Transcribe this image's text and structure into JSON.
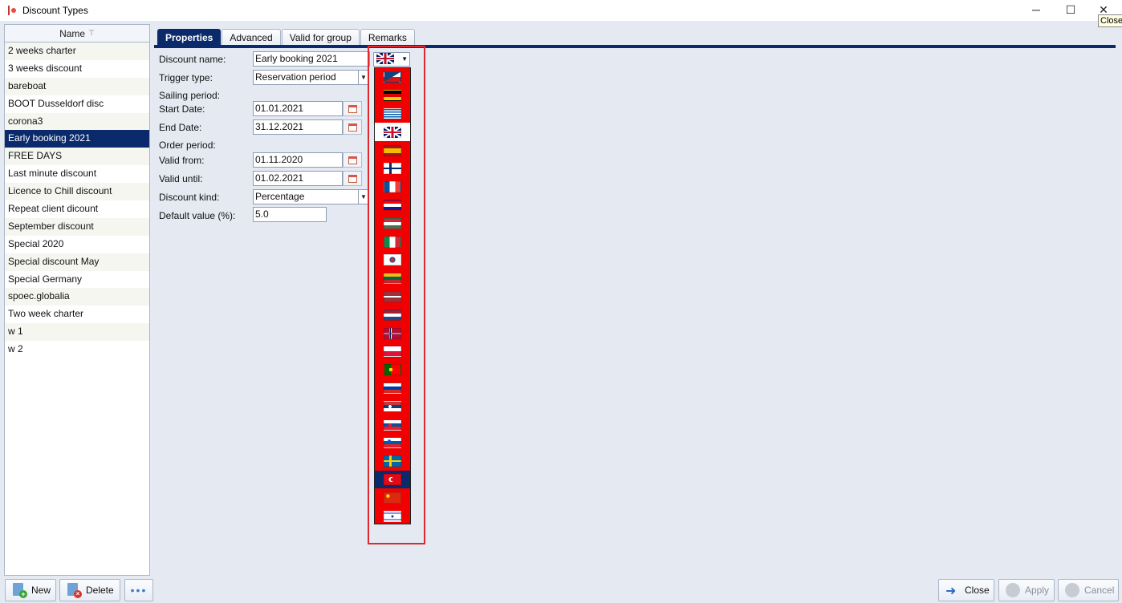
{
  "window": {
    "title": "Discount Types",
    "tooltip": "Close",
    "minimize_glyph": "─",
    "maximize_glyph": "☐",
    "close_glyph": "✕"
  },
  "list": {
    "header": "Name",
    "sort_glyph": "⊤",
    "items": [
      "2 weeks charter",
      "3 weeks discount",
      "bareboat",
      "BOOT Dusseldorf disc",
      "corona3",
      "Early booking 2021",
      "FREE DAYS",
      "Last minute discount",
      "Licence to Chill discount",
      "Repeat client dicount",
      "September discount",
      "Special 2020",
      "Special discount May",
      "Special Germany",
      "spoec.globalia",
      "Two week charter",
      "w 1",
      "w 2"
    ],
    "selected_index": 5
  },
  "tabs": [
    "Properties",
    "Advanced",
    "Valid for group",
    "Remarks"
  ],
  "form": {
    "discount_name_label": "Discount name:",
    "discount_name_value": "Early booking 2021",
    "trigger_type_label": "Trigger type:",
    "trigger_type_value": "Reservation period",
    "sailing_period_label": "Sailing period:",
    "start_date_label": "Start Date:",
    "start_date_value": "01.01.2021",
    "end_date_label": "End Date:",
    "end_date_value": "31.12.2021",
    "order_period_label": "Order period:",
    "valid_from_label": "Valid from:",
    "valid_from_value": "01.11.2020",
    "valid_until_label": "Valid until:",
    "valid_until_value": "01.02.2021",
    "discount_kind_label": "Discount kind:",
    "discount_kind_value": "Percentage",
    "default_value_label": "Default value (%):",
    "default_value_value": "5.0"
  },
  "language_dropdown": {
    "selected": "uk-flag-icon",
    "options": [
      "czech-flag-icon",
      "german-flag-icon",
      "greek-flag-icon",
      "uk-flag-icon",
      "spanish-flag-icon",
      "finnish-flag-icon",
      "french-flag-icon",
      "croatian-flag-icon",
      "hungarian-flag-icon",
      "italian-flag-icon",
      "korean-flag-icon",
      "lithuanian-flag-icon",
      "latvian-flag-icon",
      "dutch-flag-icon",
      "norwegian-flag-icon",
      "polish-flag-icon",
      "portuguese-flag-icon",
      "russian-flag-icon",
      "serbian-flag-icon",
      "slovak-flag-icon",
      "slovenian-flag-icon",
      "swedish-flag-icon",
      "turkish-flag-icon",
      "chinese-flag-icon",
      "israeli-flag-icon"
    ],
    "hover_index": 3,
    "active_index": 22,
    "list_color": "#f00000"
  },
  "buttons": {
    "new": "New",
    "delete": "Delete",
    "more": "•••",
    "close": "Close",
    "apply": "Apply",
    "cancel": "Cancel"
  },
  "colors": {
    "accent": "#0a2a6b",
    "annotation": "#e0292f",
    "background": "#e4e9f2"
  }
}
